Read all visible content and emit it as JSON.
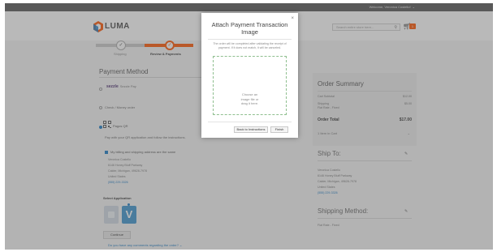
{
  "topbar": {
    "welcome": "Welcome, Veronica Costello!"
  },
  "header": {
    "brand": "LUMA",
    "search_placeholder": "Search entire store here...",
    "cart_count": "1"
  },
  "progress": {
    "step1": "Shipping",
    "step2": "Review & Payments"
  },
  "payment": {
    "title": "Payment Method",
    "sezzle_logo": "sezzle",
    "sezzle_tag": "Sezzle Pay",
    "check_option": "Check / Money order",
    "qr_label": "Pagos QR",
    "qr_desc": "Pay with your QR application and follow the instructions.",
    "same_address": "My billing and shipping address are the same",
    "address": [
      "Veronica Costello",
      "6146 Honey Bluff Parkway",
      "Calder, Michigan, 49628-7978",
      "United States",
      "(555) 229-3326"
    ],
    "select_app": "Select Application",
    "continue_label": "Continue",
    "comments_link": "Do you have any comments regarding the order?"
  },
  "summary": {
    "title": "Order Summary",
    "rows": [
      {
        "label": "Cart Subtotal",
        "value": "$12.00"
      },
      {
        "label": "Shipping",
        "sub": "Flat Rate - Fixed",
        "value": "$5.00"
      }
    ],
    "total_label": "Order Total",
    "total_value": "$17.00",
    "items_in_cart": "1 Item in Cart"
  },
  "shipto": {
    "title": "Ship To:",
    "address": [
      "Veronica Costello",
      "6146 Honey Bluff Parkway",
      "Calder, Michigan, 49628-7978",
      "United States",
      "(555) 229-3326"
    ]
  },
  "shipping_method": {
    "title": "Shipping Method:",
    "value": "Flat Rate - Fixed"
  },
  "modal": {
    "title": "Attach Payment Transaction Image",
    "close": "×",
    "description": "The order will be completed after validating the receipt of payment. If it does not match, it will be canceled.",
    "drop_line1": "Choose an",
    "drop_line2": "image file or",
    "drop_line3": "drag it here.",
    "back_label": "Back to Instructions",
    "finish_label": "Finish"
  }
}
